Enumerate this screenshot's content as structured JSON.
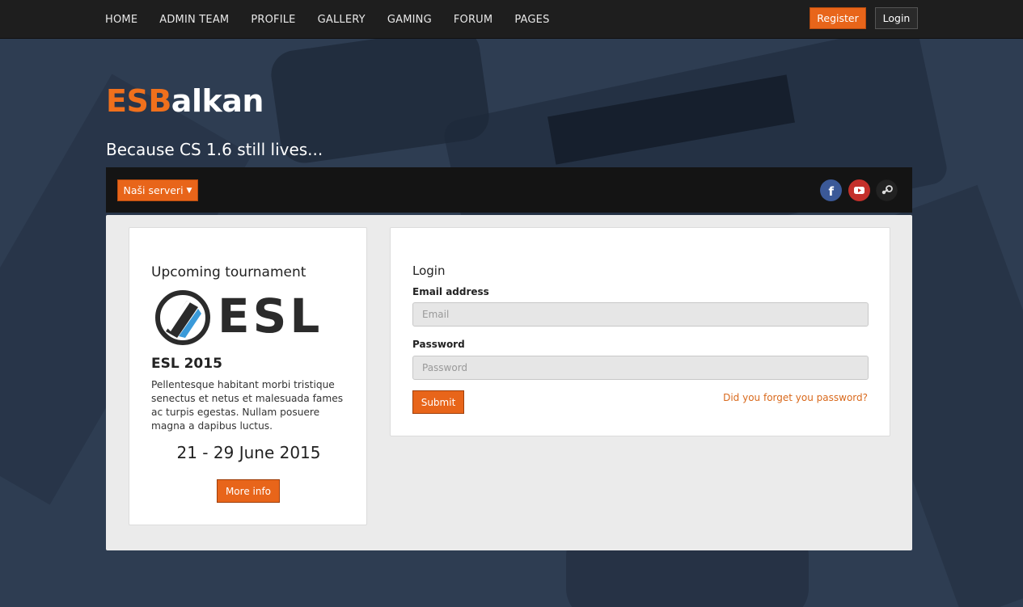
{
  "nav": {
    "items": [
      "HOME",
      "ADMIN TEAM",
      "PROFILE",
      "GALLERY",
      "GAMING",
      "FORUM",
      "PAGES"
    ],
    "register_label": "Register",
    "login_label": "Login"
  },
  "brand": {
    "part1": "ESB",
    "part2": "alkan",
    "tagline": "Because CS 1.6 still lives..."
  },
  "subbar": {
    "servers_label": "Naši serveri",
    "social": [
      "facebook-icon",
      "youtube-icon",
      "steam-icon"
    ]
  },
  "tournament": {
    "heading": "Upcoming tournament",
    "logo_text": "ESL",
    "event_title": "ESL 2015",
    "description": "Pellentesque habitant morbi tristique senectus et netus et malesuada fames ac turpis egestas. Nullam posuere magna a dapibus luctus.",
    "dates": "21 - 29 June 2015",
    "more_label": "More info"
  },
  "login": {
    "heading": "Login",
    "email_label": "Email address",
    "email_placeholder": "Email",
    "password_label": "Password",
    "password_placeholder": "Password",
    "submit_label": "Submit",
    "forgot_label": "Did you forget you password?"
  },
  "colors": {
    "accent": "#e8651a",
    "background": "#2e3d52",
    "navbar": "#1e1e1e",
    "facebook": "#3b5998",
    "youtube": "#c4302b"
  }
}
